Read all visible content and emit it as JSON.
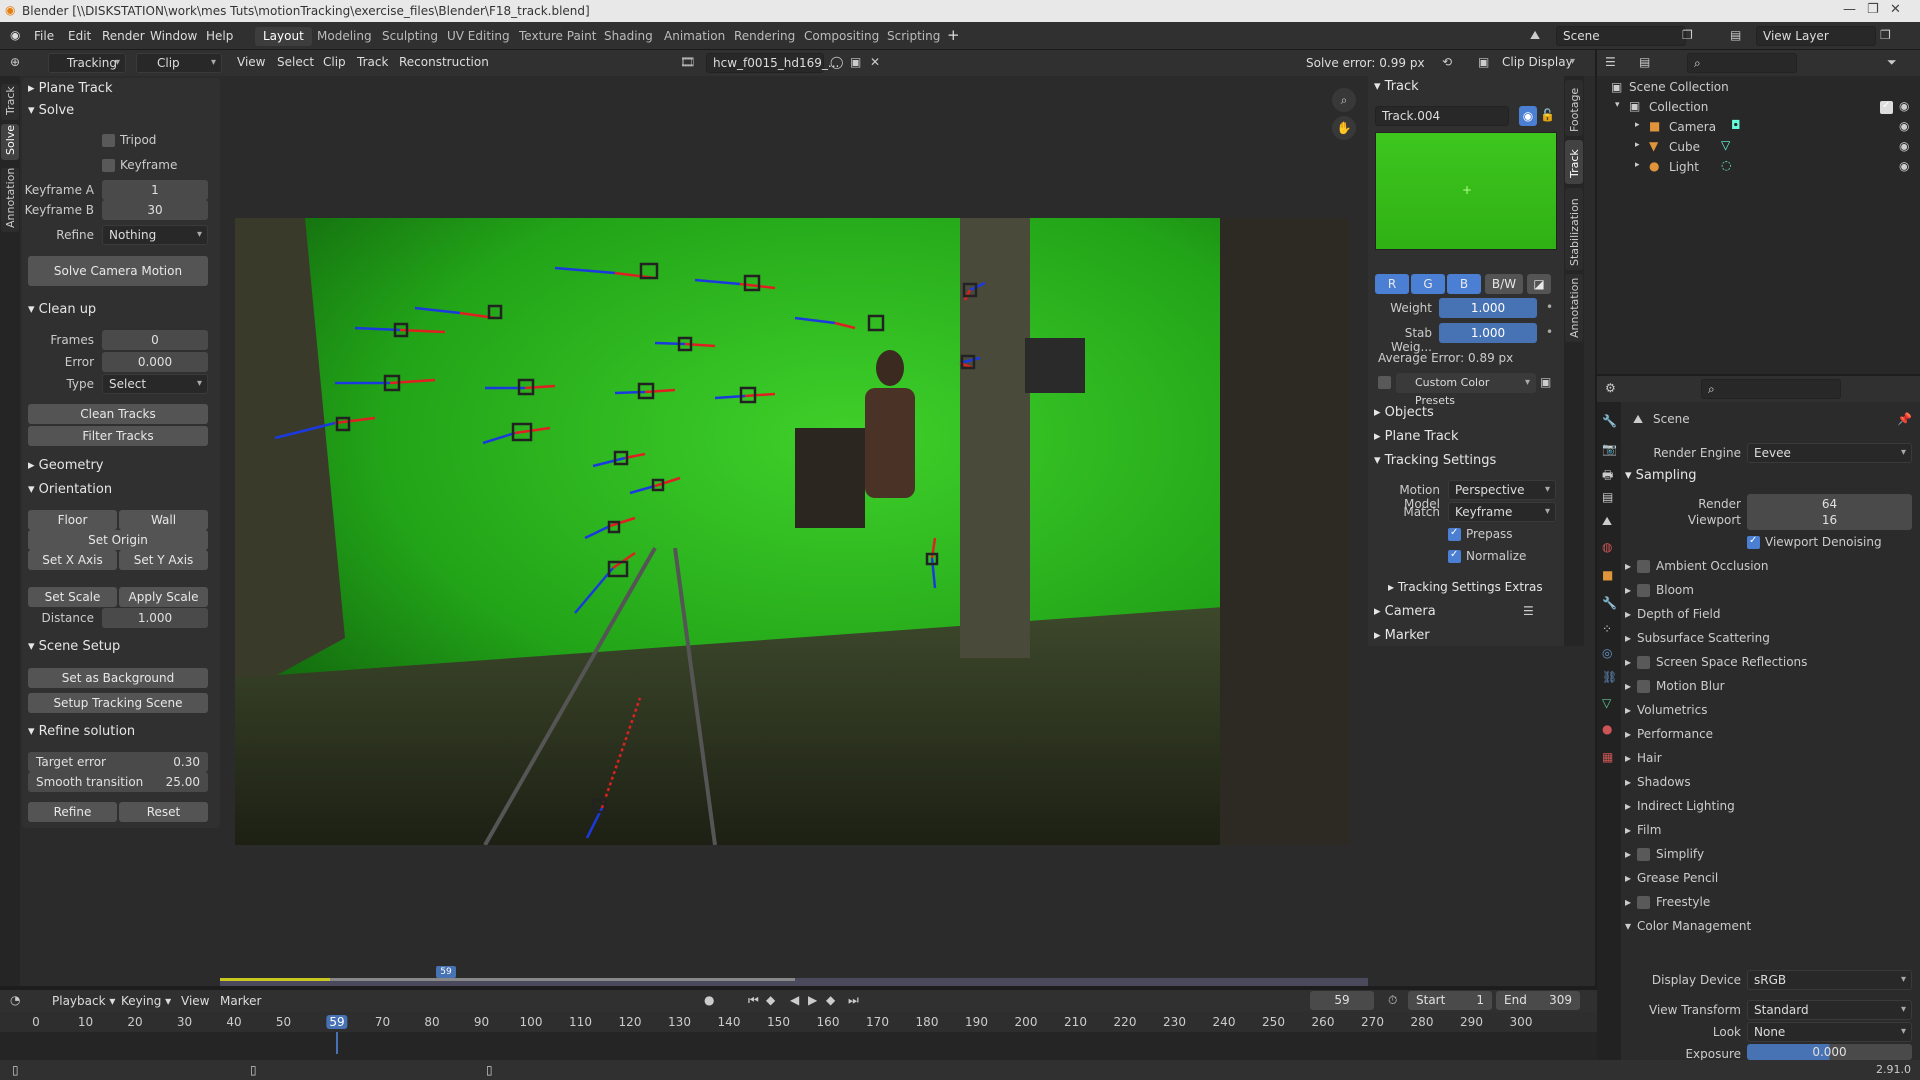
{
  "window": {
    "title": "Blender [\\\\DISKSTATION\\work\\mes Tuts\\motionTracking\\exercise_files\\Blender\\F18_track.blend]"
  },
  "menu": [
    "File",
    "Edit",
    "Render",
    "Window",
    "Help"
  ],
  "workspaces": [
    "Layout",
    "Modeling",
    "Sculpting",
    "UV Editing",
    "Texture Paint",
    "Shading",
    "Animation",
    "Rendering",
    "Compositing",
    "Scripting"
  ],
  "scene_name": "Scene",
  "view_layer_name": "View Layer",
  "clip_header": {
    "mode": "Tracking",
    "view": "Clip",
    "menus": [
      "View",
      "Select",
      "Clip",
      "Track",
      "Reconstruction"
    ],
    "clip_name": "hcw_f0015_hd169_...",
    "solve_error": "Solve error: 0.99 px",
    "clip_display": "Clip Display"
  },
  "left_tabs": [
    "Track",
    "Solve",
    "Annotation"
  ],
  "toolbar": {
    "plane_track": "Plane Track",
    "solve": {
      "title": "Solve",
      "tripod": "Tripod",
      "keyframe": "Keyframe",
      "keyframe_a_label": "Keyframe A",
      "keyframe_a": "1",
      "keyframe_b_label": "Keyframe B",
      "keyframe_b": "30",
      "refine_label": "Refine",
      "refine": "Nothing",
      "solve_button": "Solve Camera Motion"
    },
    "cleanup": {
      "title": "Clean up",
      "frames_label": "Frames",
      "frames": "0",
      "error_label": "Error",
      "error": "0.000",
      "type_label": "Type",
      "type": "Select",
      "clean_button": "Clean Tracks",
      "filter_button": "Filter Tracks"
    },
    "geometry": "Geometry",
    "orientation": {
      "title": "Orientation",
      "floor": "Floor",
      "wall": "Wall",
      "set_origin": "Set Origin",
      "set_x": "Set X Axis",
      "set_y": "Set Y Axis",
      "set_scale": "Set Scale",
      "apply_scale": "Apply Scale",
      "distance_label": "Distance",
      "distance": "1.000"
    },
    "scene_setup": {
      "title": "Scene Setup",
      "set_bg": "Set as Background",
      "setup_scene": "Setup Tracking Scene"
    },
    "refine": {
      "title": "Refine solution",
      "target_label": "Target error",
      "target": "0.30",
      "smooth_label": "Smooth transition",
      "smooth": "25.00",
      "refine_button": "Refine",
      "reset_button": "Reset"
    }
  },
  "track_panel": {
    "title": "Track",
    "track_name": "Track.004",
    "channels": [
      "R",
      "G",
      "B",
      "B/W"
    ],
    "weight_label": "Weight",
    "weight": "1.000",
    "stab_label": "Stab Weig...",
    "stab": "1.000",
    "avg_error": "Average Error: 0.89 px",
    "color_presets": "Custom Color Presets",
    "objects": "Objects",
    "plane_track": "Plane Track",
    "tracking_settings": "Tracking Settings",
    "motion_model_label": "Motion Model",
    "motion_model": "Perspective",
    "match_label": "Match",
    "match": "Keyframe",
    "prepass": "Prepass",
    "normalize": "Normalize",
    "extras": "Tracking Settings Extras",
    "camera": "Camera",
    "marker": "Marker"
  },
  "side_tabs": [
    "Footage",
    "Track",
    "Stabilization",
    "Annotation"
  ],
  "outliner": {
    "root": "Scene Collection",
    "collection": "Collection",
    "items": [
      "Camera",
      "Cube",
      "Light"
    ]
  },
  "properties": {
    "context": "Scene",
    "render_engine_label": "Render Engine",
    "render_engine": "Eevee",
    "sampling": "Sampling",
    "render_label": "Render",
    "render": "64",
    "viewport_label": "Viewport",
    "viewport": "16",
    "viewport_denoising": "Viewport Denoising",
    "sections": [
      "Ambient Occlusion",
      "Bloom",
      "Depth of Field",
      "Subsurface Scattering",
      "Screen Space Reflections",
      "Motion Blur",
      "Volumetrics",
      "Performance",
      "Hair",
      "Shadows",
      "Indirect Lighting",
      "Film",
      "Simplify",
      "Grease Pencil",
      "Freestyle"
    ],
    "color_management": "Color Management",
    "display_device_label": "Display Device",
    "display_device": "sRGB",
    "view_transform_label": "View Transform",
    "view_transform": "Standard",
    "look_label": "Look",
    "look": "None",
    "exposure_label": "Exposure",
    "exposure": "0.000"
  },
  "timeline": {
    "menus": [
      "Playback",
      "Keying",
      "View",
      "Marker"
    ],
    "current_frame": "59",
    "start_label": "Start",
    "start": "1",
    "end_label": "End",
    "end": "309",
    "ruler": [
      "0",
      "10",
      "20",
      "30",
      "40",
      "50",
      "59",
      "70",
      "80",
      "90",
      "100",
      "110",
      "120",
      "130",
      "140",
      "150",
      "160",
      "170",
      "180",
      "190",
      "200",
      "210",
      "220",
      "230",
      "240",
      "250",
      "260",
      "270",
      "280",
      "290",
      "300"
    ],
    "clip_frame_marker": "59"
  },
  "status": {
    "version": "2.91.0"
  }
}
